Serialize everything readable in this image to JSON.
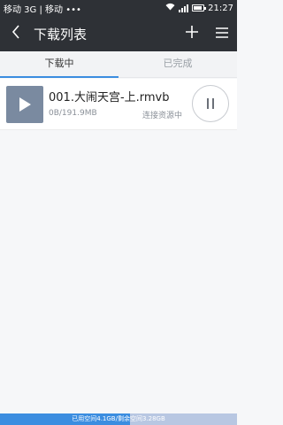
{
  "status_bar": {
    "carrier": "移动 3G | 移动 •••",
    "time": "21:27"
  },
  "app_bar": {
    "title": "下载列表",
    "icons": {
      "back": "back-icon",
      "add": "plus-icon",
      "menu": "menu-icon"
    }
  },
  "tabs": [
    {
      "label": "下载中",
      "active": true
    },
    {
      "label": "已完成",
      "active": false
    }
  ],
  "downloads": [
    {
      "name": "001.大闹天宫-上.rmvb",
      "size": "0B/191.9MB",
      "status": "连接资源中",
      "thumb_icon": "video-play-icon",
      "action_icon": "pause-icon"
    }
  ],
  "storage": {
    "text": "已用空间4.1GB/剩余空间3.28GB",
    "used_fraction": 0.55
  },
  "colors": {
    "header_bg": "#2e3136",
    "accent": "#3b8de0",
    "page_bg": "#f6f7f9"
  }
}
